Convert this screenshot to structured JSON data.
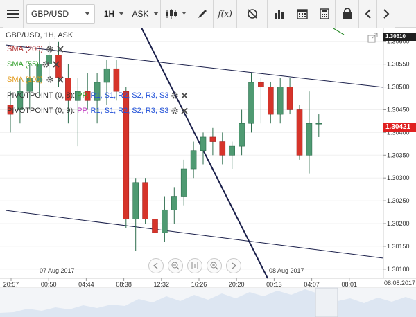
{
  "toolbar": {
    "menu_icon": "hamburger-icon",
    "symbol": "GBP/USD",
    "timeframe": "1H",
    "price_type": "ASK",
    "buttons": [
      "candlestick-icon",
      "pencil-icon",
      "function-icon",
      "compass-icon",
      "bar-chart-icon",
      "calendar-icon",
      "calculator-icon",
      "lock-icon",
      "arrow-left-icon",
      "arrow-right-icon"
    ],
    "function_label": "f(x)"
  },
  "chart": {
    "header": "GBP/USD, 1H, ASK",
    "current_price": "1.30421",
    "top_price": "1.30610",
    "date_axis_end": "08.08.2017",
    "date_labels": [
      "07 Aug 2017",
      "08 Aug 2017"
    ],
    "indicators": [
      {
        "label": "SMA (200)",
        "color": "#b03030"
      },
      {
        "label": "SMA (55)",
        "color": "#33a02c"
      },
      {
        "label": "SMA (100)",
        "color": "#e39a1a"
      }
    ],
    "pivot1": {
      "prefix": "PIVOTPOINT (0, 8):",
      "pp": "PP,",
      "r1": "R1,",
      "s1": "S1,",
      "r2": "R2,",
      "s2": "S2,",
      "r3": "R3,",
      "s3": "S3"
    },
    "pivot2": {
      "prefix": "PIVOTPOINT (0, 9):",
      "pp": "PP,",
      "r1": "R1,",
      "s1": "S1,",
      "r2": "R2,",
      "s2": "S2,",
      "r3": "R3,",
      "s3": "S3"
    },
    "price_ticks": [
      "1.30600",
      "1.30550",
      "1.30500",
      "1.30450",
      "1.30400",
      "1.30350",
      "1.30300",
      "1.30250",
      "1.30200",
      "1.30150",
      "1.30100"
    ],
    "time_ticks": [
      "20:57",
      "00:50",
      "04:44",
      "08:38",
      "12:32",
      "16:26",
      "20:20",
      "00:13",
      "04:07",
      "08:01"
    ]
  },
  "chart_data": {
    "type": "candlestick",
    "title": "GBP/USD, 1H, ASK",
    "ylim": [
      1.3008,
      1.3063
    ],
    "candles": [
      {
        "o": 1.3046,
        "h": 1.3049,
        "l": 1.304,
        "c": 1.3044
      },
      {
        "o": 1.3045,
        "h": 1.3052,
        "l": 1.3042,
        "c": 1.3049
      },
      {
        "o": 1.3049,
        "h": 1.3055,
        "l": 1.3045,
        "c": 1.3052
      },
      {
        "o": 1.3051,
        "h": 1.3058,
        "l": 1.3048,
        "c": 1.3055
      },
      {
        "o": 1.3055,
        "h": 1.306,
        "l": 1.3052,
        "c": 1.3057
      },
      {
        "o": 1.3057,
        "h": 1.306,
        "l": 1.305,
        "c": 1.3052
      },
      {
        "o": 1.3052,
        "h": 1.3055,
        "l": 1.3042,
        "c": 1.3047
      },
      {
        "o": 1.3047,
        "h": 1.3052,
        "l": 1.3037,
        "c": 1.3049
      },
      {
        "o": 1.3049,
        "h": 1.3053,
        "l": 1.3045,
        "c": 1.3047
      },
      {
        "o": 1.3047,
        "h": 1.3053,
        "l": 1.3042,
        "c": 1.3051
      },
      {
        "o": 1.3051,
        "h": 1.3056,
        "l": 1.3046,
        "c": 1.3054
      },
      {
        "o": 1.3054,
        "h": 1.3056,
        "l": 1.3047,
        "c": 1.3049
      },
      {
        "o": 1.3049,
        "h": 1.305,
        "l": 1.3019,
        "c": 1.3021
      },
      {
        "o": 1.3021,
        "h": 1.303,
        "l": 1.3014,
        "c": 1.3029
      },
      {
        "o": 1.3029,
        "h": 1.303,
        "l": 1.302,
        "c": 1.3021
      },
      {
        "o": 1.3021,
        "h": 1.3025,
        "l": 1.3016,
        "c": 1.3018
      },
      {
        "o": 1.3018,
        "h": 1.3026,
        "l": 1.3016,
        "c": 1.3023
      },
      {
        "o": 1.3023,
        "h": 1.3028,
        "l": 1.302,
        "c": 1.3026
      },
      {
        "o": 1.3026,
        "h": 1.3034,
        "l": 1.3024,
        "c": 1.3032
      },
      {
        "o": 1.3032,
        "h": 1.3038,
        "l": 1.303,
        "c": 1.3036
      },
      {
        "o": 1.3036,
        "h": 1.304,
        "l": 1.3033,
        "c": 1.3039
      },
      {
        "o": 1.3039,
        "h": 1.3041,
        "l": 1.3035,
        "c": 1.3038
      },
      {
        "o": 1.3038,
        "h": 1.304,
        "l": 1.3033,
        "c": 1.3035
      },
      {
        "o": 1.3035,
        "h": 1.3038,
        "l": 1.3032,
        "c": 1.3037
      },
      {
        "o": 1.3037,
        "h": 1.3045,
        "l": 1.3035,
        "c": 1.3042
      },
      {
        "o": 1.3042,
        "h": 1.3053,
        "l": 1.304,
        "c": 1.3051
      },
      {
        "o": 1.3051,
        "h": 1.3052,
        "l": 1.3042,
        "c": 1.305
      },
      {
        "o": 1.305,
        "h": 1.3051,
        "l": 1.3042,
        "c": 1.3044
      },
      {
        "o": 1.3044,
        "h": 1.3052,
        "l": 1.3042,
        "c": 1.305
      },
      {
        "o": 1.305,
        "h": 1.3052,
        "l": 1.3044,
        "c": 1.3045
      },
      {
        "o": 1.3045,
        "h": 1.3046,
        "l": 1.3034,
        "c": 1.3035
      },
      {
        "o": 1.3035,
        "h": 1.3049,
        "l": 1.3031,
        "c": 1.3042
      },
      {
        "o": 1.3042,
        "h": 1.3044,
        "l": 1.3039,
        "c": 1.3042
      }
    ],
    "current_price": 1.30421,
    "xlabel": "",
    "ylabel": ""
  },
  "colors": {
    "bull": "#4f9a72",
    "bear": "#d6342a",
    "current": "#e02020",
    "trend": "#1a1f4a"
  }
}
